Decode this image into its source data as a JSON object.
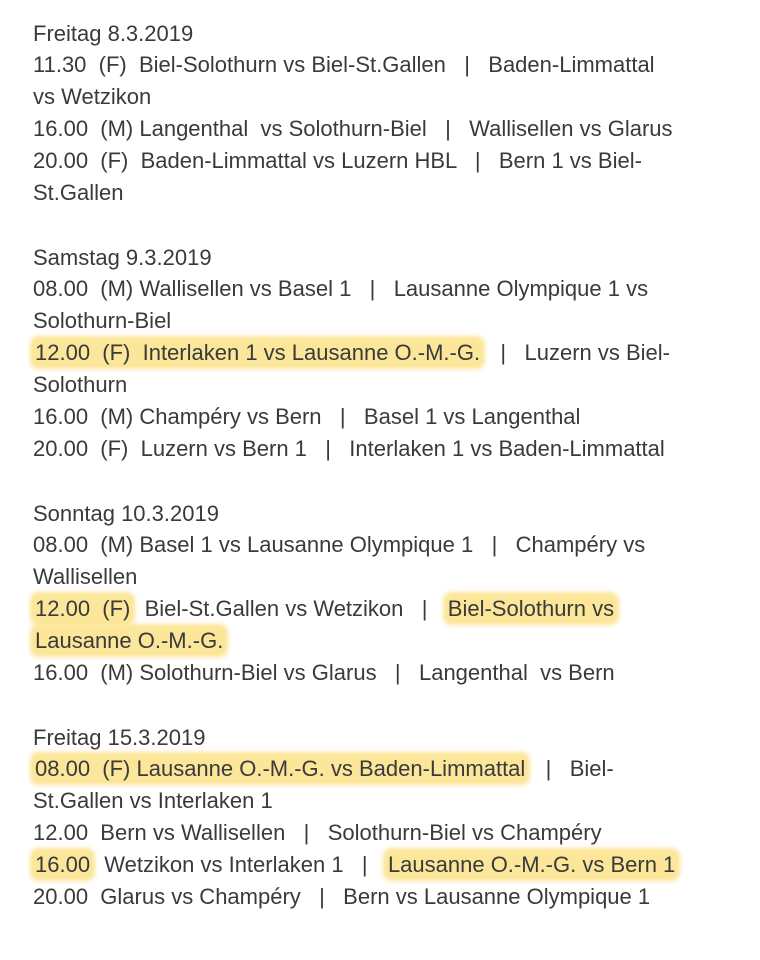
{
  "days": [
    {
      "title": "Freitag 8.3.2019",
      "lines": [
        [
          {
            "t": "11.30  (F)  Biel-Solothurn vs Biel-St.Gallen   |   Baden-Limmattal"
          }
        ],
        [
          {
            "t": "vs Wetzikon"
          }
        ],
        [
          {
            "t": "16.00  (M) Langenthal  vs Solothurn-Biel   |   Wallisellen vs Glarus"
          }
        ],
        [
          {
            "t": "20.00  (F)  Baden-Limmattal vs Luzern HBL   |   Bern 1 vs Biel-"
          }
        ],
        [
          {
            "t": "St.Gallen"
          }
        ]
      ]
    },
    {
      "title": "Samstag 9.3.2019",
      "lines": [
        [
          {
            "t": "08.00  (M) Wallisellen vs Basel 1   |   Lausanne Olympique 1 vs"
          }
        ],
        [
          {
            "t": "Solothurn-Biel"
          }
        ],
        [
          {
            "t": "12.00  (F)  Interlaken 1 vs Lausanne O.-M.-G.",
            "hl": true
          },
          {
            "t": "   |   Luzern vs Biel-"
          }
        ],
        [
          {
            "t": "Solothurn"
          }
        ],
        [
          {
            "t": "16.00  (M) Champéry vs Bern   |   Basel 1 vs Langenthal"
          }
        ],
        [
          {
            "t": "20.00  (F)  Luzern vs Bern 1   |   Interlaken 1 vs Baden-Limmattal"
          }
        ]
      ]
    },
    {
      "title": "Sonntag 10.3.2019",
      "lines": [
        [
          {
            "t": "08.00  (M) Basel 1 vs Lausanne Olympique 1   |   Champéry vs"
          }
        ],
        [
          {
            "t": "Wallisellen"
          }
        ],
        [
          {
            "t": "12.00  (F)",
            "hl": true
          },
          {
            "t": "  Biel-St.Gallen vs Wetzikon   |   "
          },
          {
            "t": "Biel-Solothurn vs",
            "hl": true
          }
        ],
        [
          {
            "t": "Lausanne O.-M.-G.",
            "hl": true
          }
        ],
        [
          {
            "t": "16.00  (M) Solothurn-Biel vs Glarus   |   Langenthal  vs Bern"
          }
        ]
      ]
    },
    {
      "title": "Freitag 15.3.2019",
      "lines": [
        [
          {
            "t": "08.00  (F) Lausanne O.-M.-G. vs Baden-Limmattal",
            "hl": true
          },
          {
            "t": "   |   Biel-"
          }
        ],
        [
          {
            "t": "St.Gallen vs Interlaken 1"
          }
        ],
        [
          {
            "t": "12.00  Bern vs Wallisellen   |   Solothurn-Biel vs Champéry"
          }
        ],
        [
          {
            "t": "16.00",
            "hl": true
          },
          {
            "t": "  Wetzikon vs Interlaken 1   |   "
          },
          {
            "t": "Lausanne O.-M.-G. vs Bern 1",
            "hl": true
          }
        ],
        [
          {
            "t": "20.00  Glarus vs Champéry   |   Bern vs Lausanne Olympique 1"
          }
        ]
      ]
    }
  ]
}
